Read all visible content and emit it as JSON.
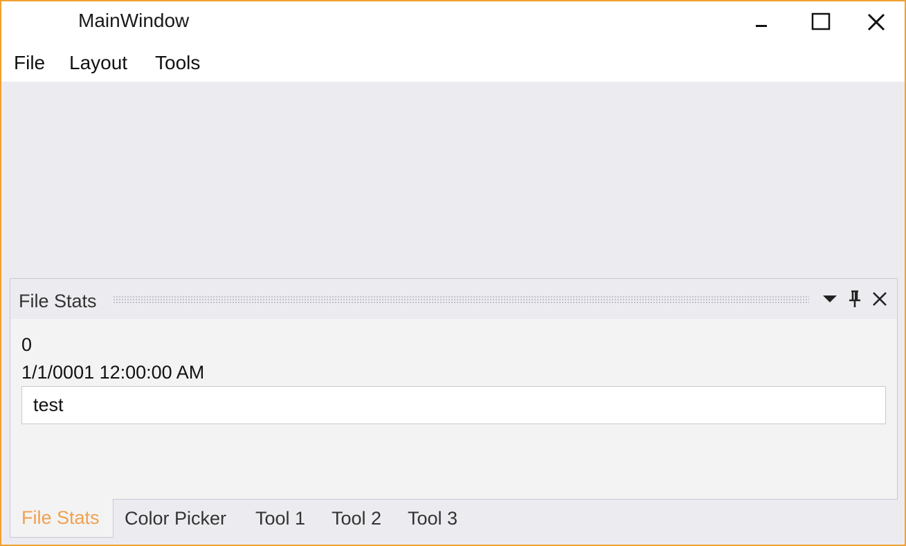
{
  "window": {
    "title": "MainWindow",
    "accent_color": "#f0a030"
  },
  "menu": {
    "items": [
      {
        "label": "File"
      },
      {
        "label": "Layout"
      },
      {
        "label": "Tools"
      }
    ]
  },
  "panel": {
    "title": "File Stats",
    "count": "0",
    "date": "1/1/0001 12:00:00 AM",
    "input_value": "test"
  },
  "tabs": [
    {
      "label": "File Stats",
      "active": true
    },
    {
      "label": "Color Picker",
      "active": false
    },
    {
      "label": "Tool 1",
      "active": false
    },
    {
      "label": "Tool 2",
      "active": false
    },
    {
      "label": "Tool 3",
      "active": false
    }
  ],
  "icons": {
    "minimize": "minimize-icon",
    "maximize": "maximize-icon",
    "close": "close-icon",
    "dropdown": "caret-down-icon",
    "pin": "pin-icon",
    "panel_close": "close-icon"
  }
}
